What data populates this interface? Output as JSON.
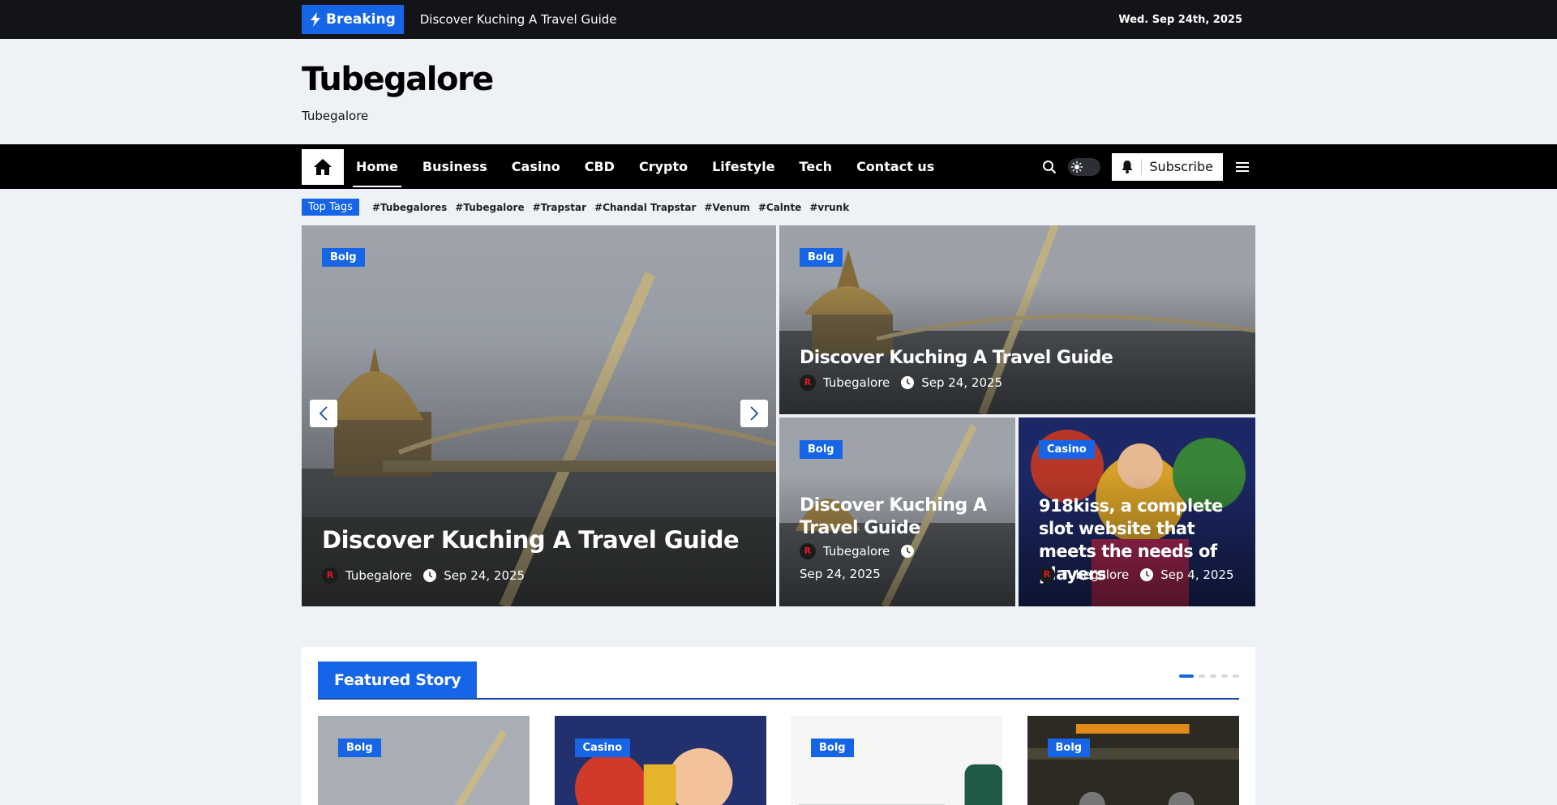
{
  "topbar": {
    "breaking_label": "Breaking",
    "breaking_text": "Discover Kuching A Travel Guide",
    "date": "Wed. Sep 24th, 2025"
  },
  "header": {
    "site_title": "Tubegalore",
    "tagline": "Tubegalore"
  },
  "nav": {
    "items": [
      "Home",
      "Business",
      "Casino",
      "CBD",
      "Crypto",
      "Lifestyle",
      "Tech",
      "Contact us"
    ],
    "subscribe_label": "Subscribe"
  },
  "tags": {
    "label": "Top Tags",
    "items": [
      "#Tubegalores",
      "#Tubegalore",
      "#Trapstar",
      "#Chandal Trapstar",
      "#Venum",
      "#Calnte",
      "#vrunk"
    ]
  },
  "hero": {
    "main": {
      "category": "Bolg",
      "title": "Discover Kuching A Travel Guide",
      "author": "Tubegalore",
      "date": "Sep 24, 2025"
    },
    "top_right": {
      "category": "Bolg",
      "title": "Discover Kuching A Travel Guide",
      "author": "Tubegalore",
      "date": "Sep 24, 2025"
    },
    "bottom_left": {
      "category": "Bolg",
      "title": "Discover Kuching A Travel Guide",
      "author": "Tubegalore",
      "date": "Sep 24, 2025"
    },
    "bottom_right": {
      "category": "Casino",
      "title": "918kiss, a complete slot website that meets the needs of players",
      "author": "Tubegalore",
      "date": "Sep 4, 2025"
    }
  },
  "featured": {
    "title": "Featured Story",
    "cards": [
      {
        "category": "Bolg"
      },
      {
        "category": "Casino"
      },
      {
        "category": "Bolg"
      },
      {
        "category": "Bolg"
      }
    ]
  },
  "colors": {
    "accent": "#1565e6",
    "topbar": "#121418",
    "nav": "#000000",
    "page": "#eef2f7"
  },
  "icons": [
    "bolt-icon",
    "home-icon",
    "search-icon",
    "sun-icon",
    "bell-icon",
    "menu-icon",
    "clock-icon",
    "chevron-left-icon",
    "chevron-right-icon"
  ]
}
